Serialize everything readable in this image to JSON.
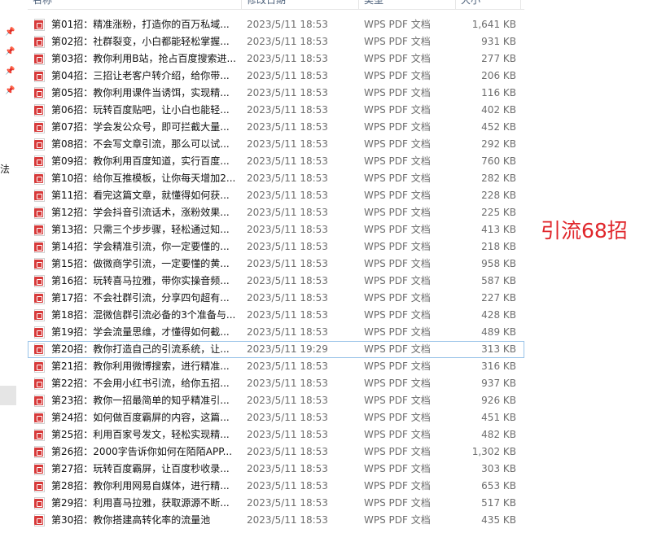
{
  "header": {
    "name": "名称",
    "date": "修改日期",
    "type": "类型",
    "size": "大小"
  },
  "nav": {
    "partial_text": "法"
  },
  "files": [
    {
      "name": "第01招：精准涨粉，打造你的百万私域...",
      "date": "2023/5/11 18:53",
      "type": "WPS PDF 文档",
      "size": "1,641 KB"
    },
    {
      "name": "第02招：社群裂变，小白都能轻松掌握...",
      "date": "2023/5/11 18:53",
      "type": "WPS PDF 文档",
      "size": "931 KB"
    },
    {
      "name": "第03招：教你利用B站，抢占百度搜索进...",
      "date": "2023/5/11 18:53",
      "type": "WPS PDF 文档",
      "size": "277 KB"
    },
    {
      "name": "第04招：三招让老客户转介绍，给你带...",
      "date": "2023/5/11 18:53",
      "type": "WPS PDF 文档",
      "size": "206 KB"
    },
    {
      "name": "第05招：教你利用课件当诱饵，实现精...",
      "date": "2023/5/11 18:53",
      "type": "WPS PDF 文档",
      "size": "116 KB"
    },
    {
      "name": "第06招：玩转百度贴吧，让小白也能轻...",
      "date": "2023/5/11 18:53",
      "type": "WPS PDF 文档",
      "size": "402 KB"
    },
    {
      "name": "第07招：学会发公众号，即可拦截大量...",
      "date": "2023/5/11 18:53",
      "type": "WPS PDF 文档",
      "size": "452 KB"
    },
    {
      "name": "第08招：不会写文章引流，那么可以试...",
      "date": "2023/5/11 18:53",
      "type": "WPS PDF 文档",
      "size": "292 KB"
    },
    {
      "name": "第09招：教你利用百度知道，实行百度...",
      "date": "2023/5/11 18:53",
      "type": "WPS PDF 文档",
      "size": "760 KB"
    },
    {
      "name": "第10招：给你互推模板，让你每天增加2...",
      "date": "2023/5/11 18:53",
      "type": "WPS PDF 文档",
      "size": "282 KB"
    },
    {
      "name": "第11招：看完这篇文章，就懂得如何获...",
      "date": "2023/5/11 18:53",
      "type": "WPS PDF 文档",
      "size": "228 KB"
    },
    {
      "name": "第12招：学会抖音引流话术，涨粉效果...",
      "date": "2023/5/11 18:53",
      "type": "WPS PDF 文档",
      "size": "225 KB"
    },
    {
      "name": "第13招：只需三个步步骤，轻松通过知...",
      "date": "2023/5/11 18:53",
      "type": "WPS PDF 文档",
      "size": "413 KB"
    },
    {
      "name": "第14招：学会精准引流，你一定要懂的...",
      "date": "2023/5/11 18:53",
      "type": "WPS PDF 文档",
      "size": "218 KB"
    },
    {
      "name": "第15招：做微商学引流，一定要懂的黄...",
      "date": "2023/5/11 18:53",
      "type": "WPS PDF 文档",
      "size": "958 KB"
    },
    {
      "name": "第16招：玩转喜马拉雅，带你实操音频...",
      "date": "2023/5/11 18:53",
      "type": "WPS PDF 文档",
      "size": "587 KB"
    },
    {
      "name": "第17招：不会社群引流，分享四句超有...",
      "date": "2023/5/11 18:53",
      "type": "WPS PDF 文档",
      "size": "227 KB"
    },
    {
      "name": "第18招：混微信群引流必备的3个准备与...",
      "date": "2023/5/11 18:53",
      "type": "WPS PDF 文档",
      "size": "428 KB"
    },
    {
      "name": "第19招：学会流量思维，才懂得如何截...",
      "date": "2023/5/11 18:53",
      "type": "WPS PDF 文档",
      "size": "489 KB"
    },
    {
      "name": "第20招：教你打造自己的引流系统，让...",
      "date": "2023/5/11 19:29",
      "type": "WPS PDF 文档",
      "size": "313 KB"
    },
    {
      "name": "第21招：教你利用微博搜索，进行精准...",
      "date": "2023/5/11 18:53",
      "type": "WPS PDF 文档",
      "size": "316 KB"
    },
    {
      "name": "第22招：不会用小红书引流，给你五招...",
      "date": "2023/5/11 18:53",
      "type": "WPS PDF 文档",
      "size": "937 KB"
    },
    {
      "name": "第23招：教你一招最简单的知乎精准引...",
      "date": "2023/5/11 18:53",
      "type": "WPS PDF 文档",
      "size": "926 KB"
    },
    {
      "name": "第24招：如何做百度霸屏的内容，这篇...",
      "date": "2023/5/11 18:53",
      "type": "WPS PDF 文档",
      "size": "451 KB"
    },
    {
      "name": "第25招：利用百家号发文，轻松实现精...",
      "date": "2023/5/11 18:53",
      "type": "WPS PDF 文档",
      "size": "482 KB"
    },
    {
      "name": "第26招：2000字告诉你如何在陌陌APP...",
      "date": "2023/5/11 18:53",
      "type": "WPS PDF 文档",
      "size": "1,302 KB"
    },
    {
      "name": "第27招：玩转百度霸屏，让百度秒收录...",
      "date": "2023/5/11 18:53",
      "type": "WPS PDF 文档",
      "size": "303 KB"
    },
    {
      "name": "第28招：教你利用网易自媒体，进行精...",
      "date": "2023/5/11 18:53",
      "type": "WPS PDF 文档",
      "size": "653 KB"
    },
    {
      "name": "第29招：利用喜马拉雅，获取源源不断...",
      "date": "2023/5/11 18:53",
      "type": "WPS PDF 文档",
      "size": "517 KB"
    },
    {
      "name": "第30招：教你搭建高转化率的流量池",
      "date": "2023/5/11 18:53",
      "type": "WPS PDF 文档",
      "size": "435 KB"
    }
  ],
  "selected_index": 19,
  "overlay_label": "引流68招",
  "colors": {
    "overlay_text": "#e0262b",
    "selection_border": "#99c3e8",
    "pdf_icon": "#d73a3a"
  }
}
